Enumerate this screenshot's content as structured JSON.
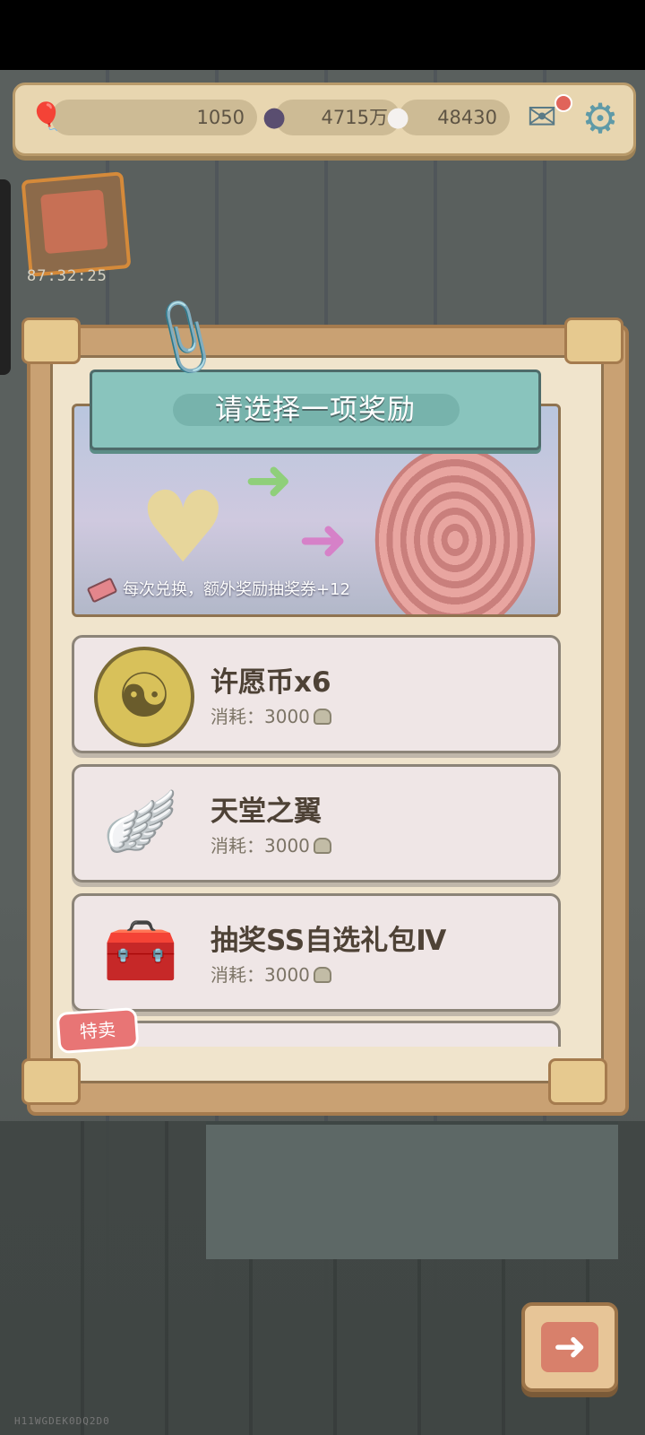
{
  "resources": {
    "balloon": {
      "value": "1050",
      "icon": "balloon-icon"
    },
    "ghost_coin": {
      "value": "4715万",
      "icon": "ghost-coin-icon"
    },
    "spirit": {
      "value": "48430",
      "icon": "spirit-icon"
    }
  },
  "event": {
    "timer": "87:32:25"
  },
  "panel": {
    "title": "请选择一项奖励",
    "banner_note": "每次兑换，额外奖励抽奖券+12"
  },
  "items": [
    {
      "name": "许愿币x6",
      "cost_label": "消耗：3000",
      "icon": "yin-yang-coin-icon"
    },
    {
      "name": "天堂之翼",
      "cost_label": "消耗：3000",
      "icon": "winged-heaven-icon"
    },
    {
      "name": "抽奖SS自选礼包Ⅳ",
      "cost_label": "消耗：3000",
      "icon": "gift-chest-icon"
    }
  ],
  "special_badge": "特卖",
  "watermark": "H11WGDEK0DQ2D0",
  "colors": {
    "title_banner": "#89c4bd",
    "panel_frame": "#c9a173",
    "badge": "#e87575"
  }
}
